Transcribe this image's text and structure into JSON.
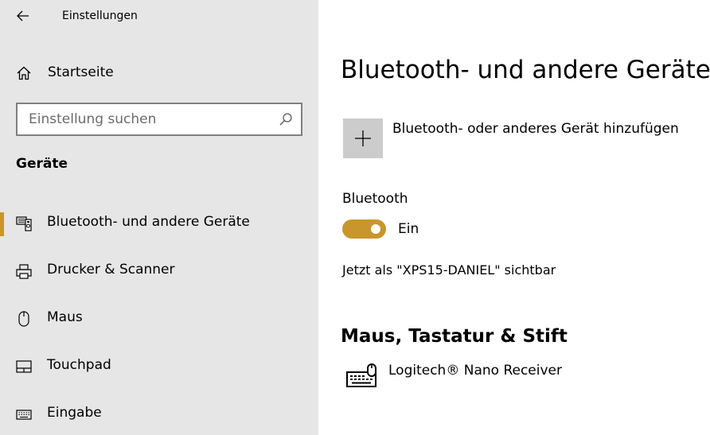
{
  "window": {
    "title": "Einstellungen"
  },
  "sidebar": {
    "home_label": "Startseite",
    "search_placeholder": "Einstellung suchen",
    "section_heading": "Geräte",
    "items": [
      {
        "label": "Bluetooth- und andere Geräte",
        "icon": "bluetooth-devices-icon",
        "selected": true
      },
      {
        "label": "Drucker & Scanner",
        "icon": "printer-icon",
        "selected": false
      },
      {
        "label": "Maus",
        "icon": "mouse-icon",
        "selected": false
      },
      {
        "label": "Touchpad",
        "icon": "touchpad-icon",
        "selected": false
      },
      {
        "label": "Eingabe",
        "icon": "keyboard-icon",
        "selected": false
      }
    ]
  },
  "main": {
    "title": "Bluetooth- und andere Geräte",
    "add_device_label": "Bluetooth- oder anderes Gerät hinzufügen",
    "bluetooth_label": "Bluetooth",
    "bluetooth_state": "Ein",
    "bluetooth_on": true,
    "visibility_text": "Jetzt als \"XPS15-DANIEL\" sichtbar",
    "section_input": "Maus, Tastatur & Stift",
    "devices": [
      {
        "name": "Logitech® Nano Receiver",
        "icon": "keyboard-mouse-icon"
      }
    ]
  },
  "colors": {
    "accent": "#c8962a",
    "sidebar_bg": "#e6e6e6",
    "add_button_bg": "#cccccc"
  }
}
